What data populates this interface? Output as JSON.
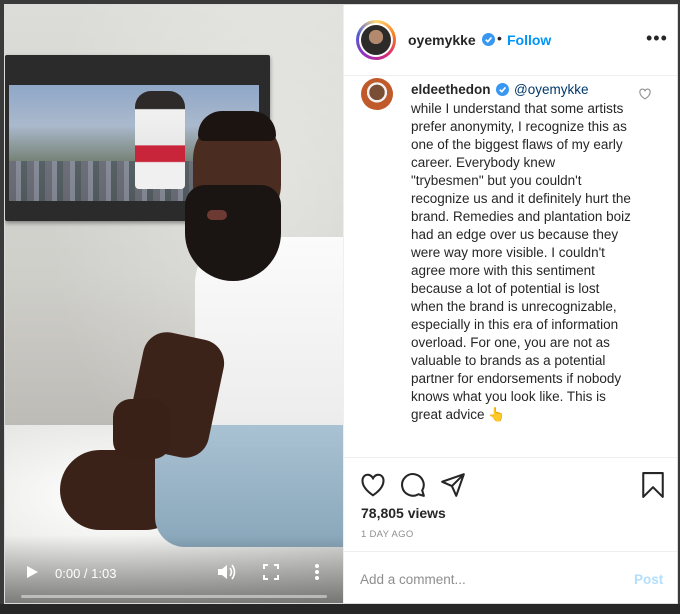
{
  "post": {
    "username": "oyemykke",
    "follow_label": "Follow",
    "separator": "•"
  },
  "comment": {
    "username": "eldeethedon",
    "mention": "@oyemykke",
    "text": "while I understand that some artists prefer anonymity, I recognize this as one of the biggest flaws of my early career. Everybody knew \"trybesmen\" but you couldn't recognize us and it definitely hurt the brand. Remedies and plantation boiz had an edge over us because they were way more visible. I couldn't agree more with this sentiment because a lot of potential is lost when the brand is unrecognizable, especially in this era of information overload. For one, you are not as valuable to brands as a potential partner for endorsements if nobody knows what you look like. This is great advice 👆"
  },
  "stats": {
    "views": "78,805 views",
    "time_ago": "1 DAY AGO"
  },
  "composer": {
    "placeholder": "Add a comment...",
    "post_label": "Post"
  },
  "video": {
    "time": "0:00 / 1:03",
    "progress": 0
  },
  "colors": {
    "accent": "#0095f6",
    "verified": "#3897f0",
    "post_disabled": "#b2dffc"
  },
  "icons": [
    "verified-icon",
    "options-icon",
    "heart-icon",
    "comment-icon",
    "share-icon",
    "bookmark-icon",
    "play-icon",
    "volume-icon",
    "fullscreen-icon",
    "more-vertical-icon"
  ]
}
